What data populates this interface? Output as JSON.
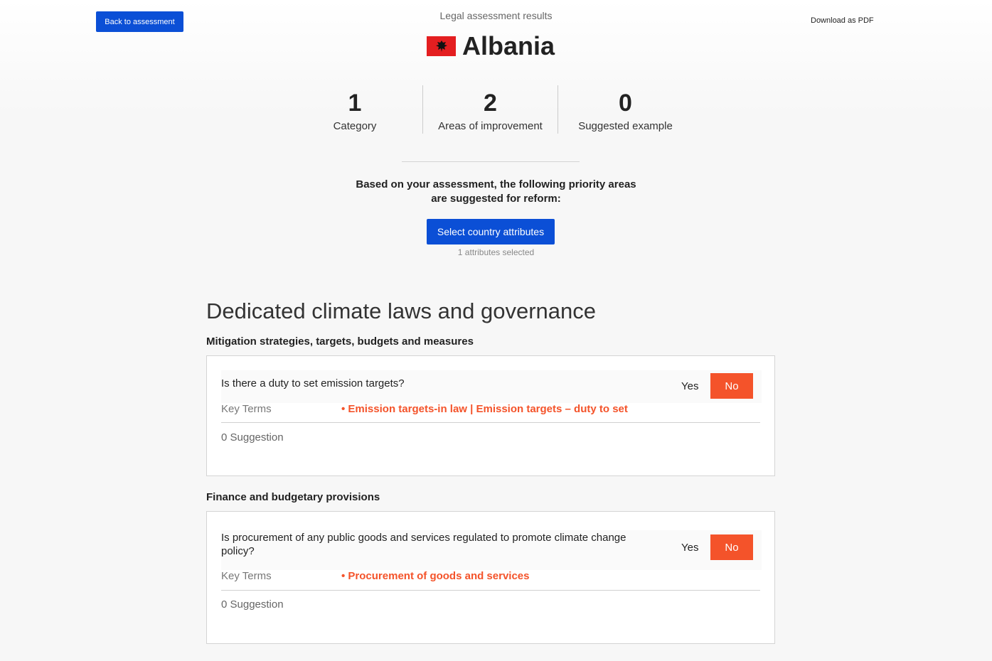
{
  "header": {
    "back_label": "Back to assessment",
    "subtitle": "Legal assessment results",
    "country": "Albania",
    "download_label": "Download as PDF",
    "flag_color": "#e41e20"
  },
  "stats": [
    {
      "value": "1",
      "label": "Category"
    },
    {
      "value": "2",
      "label": "Areas of improvement"
    },
    {
      "value": "0",
      "label": "Suggested example"
    }
  ],
  "priority": {
    "line1": "Based on your assessment, the following priority areas",
    "line2": "are suggested for reform:"
  },
  "attributes": {
    "button_label": "Select country attributes",
    "count_text": "1 attributes selected"
  },
  "section": {
    "title": "Dedicated climate laws and governance",
    "groups": [
      {
        "title": "Mitigation strategies, targets, budgets and measures",
        "question": "Is there a duty to set emission targets?",
        "yes_label": "Yes",
        "no_label": "No",
        "key_terms_label": "Key Terms",
        "key_terms": "• Emission targets-in law | Emission targets – duty to set",
        "suggestion": "0 Suggestion"
      },
      {
        "title": "Finance and budgetary provisions",
        "question": "Is procurement of any public goods and services regulated to promote climate change policy?",
        "yes_label": "Yes",
        "no_label": "No",
        "key_terms_label": "Key Terms",
        "key_terms": "• Procurement of goods and services",
        "suggestion": "0 Suggestion"
      }
    ]
  },
  "colors": {
    "primary": "#0b4fd6",
    "accent": "#f4532a"
  }
}
